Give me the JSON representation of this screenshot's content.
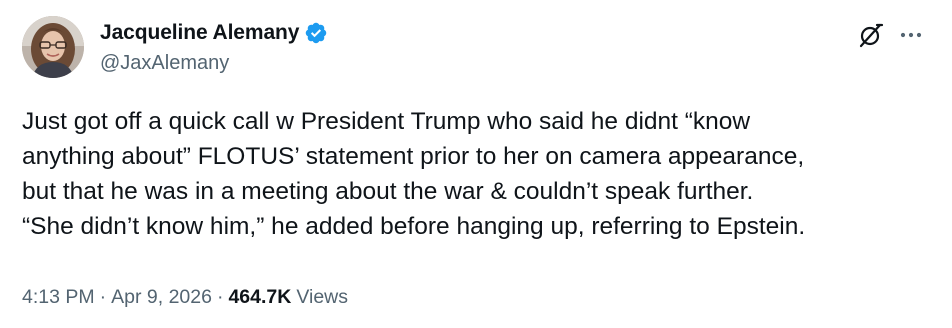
{
  "author": {
    "display_name": "Jacqueline Alemany",
    "handle": "@JaxAlemany",
    "verified": true
  },
  "tweet": {
    "lines": [
      "Just got off a quick call w President Trump who said he didnt “know",
      "anything about” FLOTUS’ statement prior to her on camera appearance,",
      "but that he was in a meeting about the war & couldn’t speak further.",
      "“She didn’t know him,” he added before hanging up, referring to Epstein."
    ],
    "time": "4:13 PM",
    "separator": "·",
    "date": "Apr 9, 2026",
    "views_count": "464.7K",
    "views_label": "Views"
  },
  "icons": {
    "verified": "verified-badge-icon",
    "grok": "grok-icon",
    "more": "more-options-icon"
  },
  "colors": {
    "text_primary": "#0f1419",
    "text_secondary": "#536471",
    "verified_blue": "#1d9bf0",
    "background": "#ffffff"
  }
}
